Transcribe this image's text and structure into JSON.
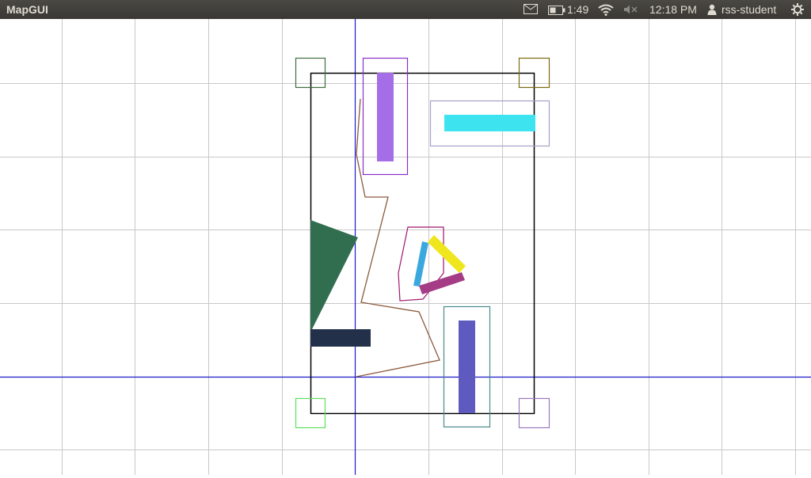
{
  "topbar": {
    "app_title": "MapGUI",
    "mail_icon": "mail-icon",
    "battery_icon": "battery-icon",
    "battery_time": "1:49",
    "wifi_icon": "wifi-icon",
    "volume_icon": "volume-muted-icon",
    "clock": "12:18 PM",
    "user_icon": "user-icon",
    "username": "rss-student",
    "power_icon": "gear-power-icon"
  },
  "map": {
    "colors": {
      "grid": "#c8c8c8",
      "axis": "#1a1acc",
      "boundary": "#000000",
      "path": "#8b5a3c"
    },
    "obstacles": [
      {
        "name": "purple-obstacle",
        "color": "#a56ee6"
      },
      {
        "name": "cyan-obstacle",
        "color": "#3de3ef"
      },
      {
        "name": "green-triangle-obstacle",
        "color": "#316e50"
      },
      {
        "name": "navy-obstacle",
        "color": "#223049"
      },
      {
        "name": "yellow-obstacle",
        "color": "#f0e61e"
      },
      {
        "name": "blue-obstacle",
        "color": "#3aa8df"
      },
      {
        "name": "magenta-obstacle",
        "color": "#a53c86"
      },
      {
        "name": "indigo-obstacle",
        "color": "#5e5abf"
      }
    ]
  }
}
